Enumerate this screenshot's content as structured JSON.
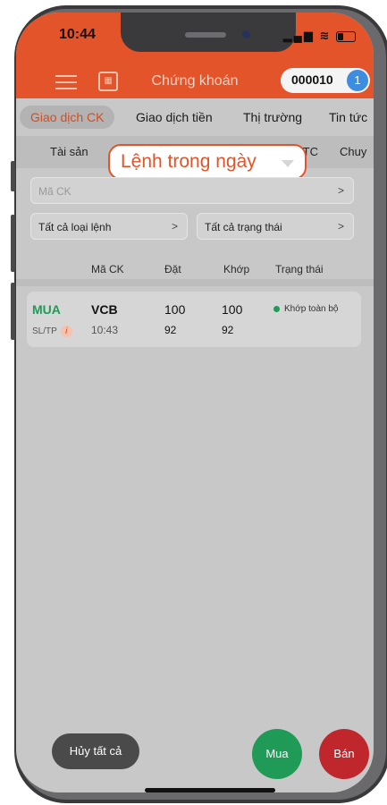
{
  "status_bar": {
    "time": "10:44"
  },
  "header": {
    "title": "Chứng khoán",
    "account_number": "000010",
    "badge_count": "1"
  },
  "main_tabs": [
    {
      "label": "Giao dịch CK",
      "active": true
    },
    {
      "label": "Giao dịch tiền",
      "active": false
    },
    {
      "label": "Thị trường",
      "active": false
    },
    {
      "label": "Tin tức",
      "active": false
    }
  ],
  "sub_tabs": [
    {
      "label": "Tài sản"
    },
    {
      "label": "VTC"
    },
    {
      "label": "Chuy"
    }
  ],
  "tooltip": {
    "label": "Lệnh trong ngày"
  },
  "filters": {
    "symbol_placeholder": "Mã CK",
    "order_type": "Tất cả loại lệnh",
    "status": "Tất cả trạng thái",
    "chevron": ">"
  },
  "table_headers": {
    "symbol": "Mã CK",
    "placed": "Đặt",
    "matched": "Khớp",
    "status": "Trạng thái"
  },
  "orders": [
    {
      "side": "MUA",
      "order_kind": "SL/TP",
      "symbol": "VCB",
      "time": "10:43",
      "placed_qty": "100",
      "placed_price": "92",
      "matched_qty": "100",
      "matched_price": "92",
      "status": "Khớp toàn bộ"
    }
  ],
  "actions": {
    "cancel_all": "Hủy tất cả",
    "buy": "Mua",
    "sell": "Bán"
  },
  "colors": {
    "brand": "#e4542a",
    "buy": "#1f9a57",
    "sell": "#c0272d",
    "badge": "#3d8ce0"
  }
}
